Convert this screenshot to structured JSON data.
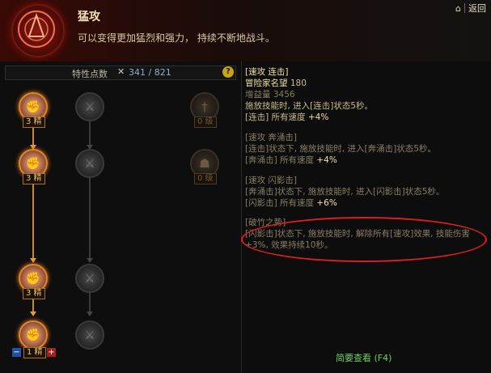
{
  "header": {
    "title": "猛攻",
    "subtitle": "可以变得更加猛烈和强力，  持续不断地战斗。",
    "back_label": "返回",
    "home_icon": "home-icon"
  },
  "points": {
    "label": "特性点数",
    "current": "341",
    "slash": "/",
    "max": "821"
  },
  "tree": {
    "nodes": [
      {
        "id": "n1",
        "state": "active",
        "badge": "3 精"
      },
      {
        "id": "n2",
        "state": "inactive"
      },
      {
        "id": "n3",
        "state": "faded",
        "badge": "0 级"
      },
      {
        "id": "n4",
        "state": "active",
        "badge": "3 精"
      },
      {
        "id": "n5",
        "state": "inactive"
      },
      {
        "id": "n6",
        "state": "faded",
        "badge": "0 级"
      },
      {
        "id": "n7",
        "state": "active",
        "badge": "3 精"
      },
      {
        "id": "n8",
        "state": "inactive"
      },
      {
        "id": "n9",
        "state": "active",
        "badge": "1 精"
      },
      {
        "id": "n10",
        "state": "inactive"
      }
    ],
    "minus": "−",
    "plus": "+"
  },
  "details": {
    "b1": {
      "title": "[速攻  连击]",
      "req_label": "冒险家名望",
      "req_val": "180",
      "gain_label": "增益量",
      "gain_val": "3456",
      "desc": "施放技能时, 进入[连击]状态5秒。",
      "effect_label": "[连击]  所有速度",
      "effect_val": "+4%"
    },
    "b2": {
      "title": "[速攻  奔涌击]",
      "desc": "[连击]状态下, 施放技能时, 进入[奔涌击]状态5秒。",
      "effect_label": "[奔涌击]  所有速度",
      "effect_val": "+4%"
    },
    "b3": {
      "title": "[速攻  闪影击]",
      "desc": "[奔涌击]状态下, 施放技能时, 进入[闪影击]状态5秒。",
      "effect_label": "[闪影击]  所有速度",
      "effect_val": "+6%"
    },
    "b4": {
      "title": "[破竹之势]",
      "line1": "[闪影击]状态下, 施放技能时, 解除所有[速攻]效果, 技能伤害",
      "line2": "+3%, 效果持续10秒。"
    }
  },
  "footer": {
    "label": "简要查看 (F4)"
  },
  "colors": {
    "accent": "#e0a030",
    "highlight_circle": "#d82020",
    "footer": "#6fcf5f"
  }
}
